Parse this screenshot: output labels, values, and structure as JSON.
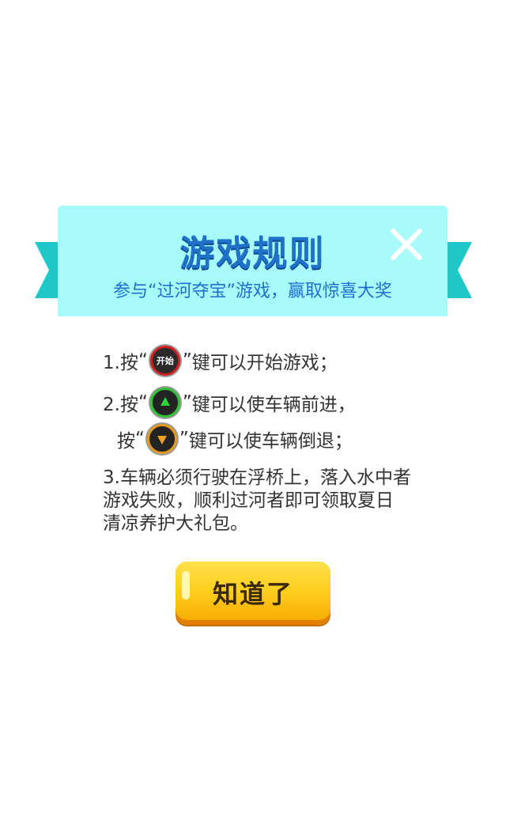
{
  "dialog": {
    "title": "游戏规则",
    "subtitle": "参与“过河夺宝”游戏，赢取惊喜大奖",
    "colors": {
      "header_bg": "#a7fbfb",
      "ribbon": "#1fc8c8",
      "title": "#1f72c8",
      "button": "#ffcf1f"
    }
  },
  "rules": {
    "rule1": {
      "prefix": "1.按",
      "open_quote": "“",
      "key_label": "开始",
      "close_quote": "”",
      "suffix": "键可以开始游戏；"
    },
    "rule2a": {
      "prefix": "2.按",
      "open_quote": "“",
      "close_quote": "”",
      "suffix": "键可以使车辆前进，"
    },
    "rule2b": {
      "prefix": "按",
      "open_quote": "“",
      "close_quote": "”",
      "suffix": "键可以使车辆倒退；"
    },
    "rule3": "3.车辆必须行驶在浮桥上，落入水中者游戏失败，顺利过河者即可领取夏日清凉养护大礼包。"
  },
  "button": {
    "label": "知道了"
  },
  "icons": {
    "close": "close-icon",
    "start_key": "start-key-icon",
    "forward_key": "up-arrow-key-icon",
    "reverse_key": "down-arrow-key-icon"
  }
}
